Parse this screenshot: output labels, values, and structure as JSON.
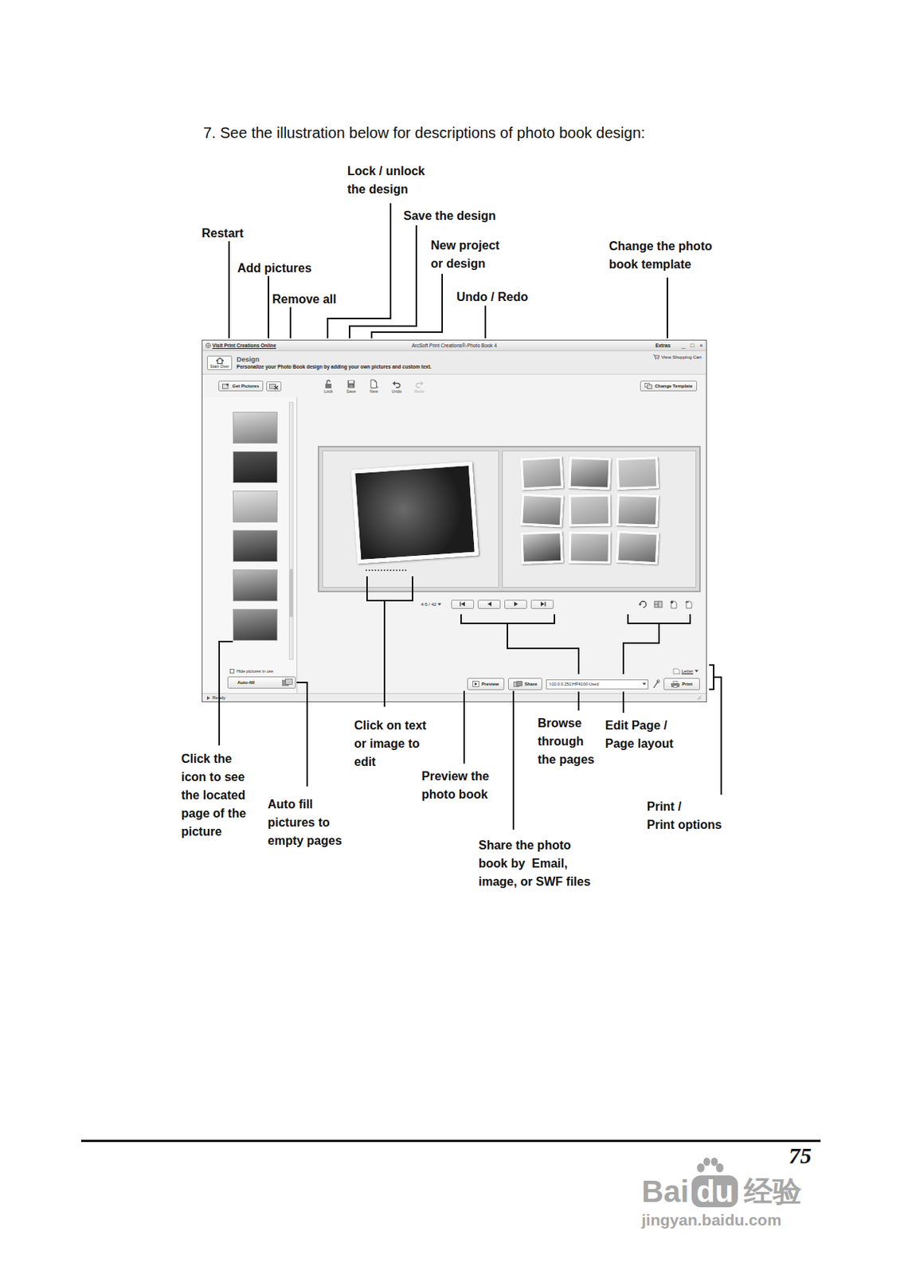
{
  "heading": "7. See the illustration below for descriptions of photo book design:",
  "window": {
    "link": "Visit Print Creations Online",
    "title": "ArcSoft Print Creations®-Photo Book 4",
    "menu": "Extras",
    "controls": [
      "_",
      "□",
      "×"
    ]
  },
  "header": {
    "start_over": "Start Over",
    "step": "Design",
    "description": "Personalize your Photo Book design by adding your own pictures and custom text.",
    "cart": "View Shopping Cart"
  },
  "toolbar": {
    "get_pictures": "Get Pictures",
    "tools": [
      {
        "label": "Lock",
        "disabled": false
      },
      {
        "label": "Save",
        "disabled": false
      },
      {
        "label": "New",
        "disabled": false
      },
      {
        "label": "Undo",
        "disabled": false
      },
      {
        "label": "Redo",
        "disabled": true
      }
    ],
    "change_template": "Change Template"
  },
  "sidebar": {
    "thumbnails": [
      {
        "selected": false
      },
      {
        "selected": false
      },
      {
        "selected": false
      },
      {
        "selected": false
      },
      {
        "selected": false
      },
      {
        "selected": false
      }
    ],
    "scrollbar": {
      "level": 0.8
    },
    "hide_in_use": {
      "label": "Hide pictures in use",
      "checked": false
    },
    "auto_fill": "Auto-fill"
  },
  "spread": {
    "left_page": [
      {
        "selected": false
      }
    ],
    "right_page": [
      {
        "selected": false
      },
      {
        "selected": false
      },
      {
        "selected": false
      },
      {
        "selected": false
      },
      {
        "selected": false
      },
      {
        "selected": false
      },
      {
        "selected": false
      },
      {
        "selected": false
      },
      {
        "selected": false
      }
    ]
  },
  "nav": {
    "pages": "4-5 / 42"
  },
  "paper": "Letter",
  "actions": {
    "preview": "Preview",
    "share": "Share",
    "printer": "\\\\10.0.0.251\\HP4100-Used",
    "print": "Print"
  },
  "status": "Ready",
  "callouts": [
    {
      "lines": [
        "Lock / unlock",
        "the design"
      ]
    },
    {
      "lines": [
        "Save the design"
      ]
    },
    {
      "lines": [
        "Restart"
      ]
    },
    {
      "lines": [
        "New project",
        "or design"
      ]
    },
    {
      "lines": [
        "Change the photo",
        "book template"
      ]
    },
    {
      "lines": [
        "Add pictures"
      ]
    },
    {
      "lines": [
        "Remove all"
      ]
    },
    {
      "lines": [
        "Undo / Redo"
      ]
    },
    {
      "lines": [
        "Click on text",
        "or image to",
        "edit"
      ]
    },
    {
      "lines": [
        "Browse",
        "through",
        "the pages"
      ]
    },
    {
      "lines": [
        "Edit Page /",
        "Page layout"
      ]
    },
    {
      "lines": [
        "Preview the",
        "photo book"
      ]
    },
    {
      "lines": [
        "Click the",
        "icon to see",
        "the located",
        "page of the",
        "picture"
      ]
    },
    {
      "lines": [
        "Auto fill",
        "pictures to",
        "empty pages"
      ]
    },
    {
      "lines": [
        "Print /",
        "Print options"
      ]
    },
    {
      "lines": [
        "Share the photo",
        "book by  Email,",
        "image, or SWF files"
      ]
    }
  ],
  "page_number": "75",
  "watermark": {
    "brand": "Bai",
    "brand_paw": "du",
    "brand_cn": "经验",
    "url": "jingyan.baidu.com"
  }
}
